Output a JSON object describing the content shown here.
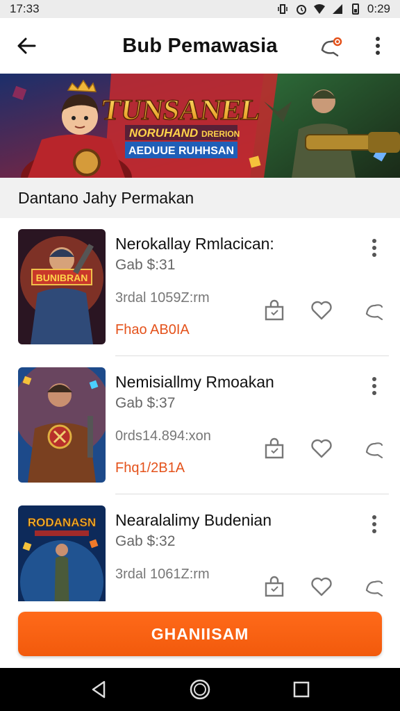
{
  "status": {
    "time": "17:33",
    "battery_time": "0:29"
  },
  "appbar": {
    "title": "Bub Pemawasia"
  },
  "banner": {
    "title": "TUNSANEL",
    "line1_a": "NORUHAND",
    "line1_b": "DRERION",
    "line2": "AEDUUE RUHHSAN"
  },
  "section": {
    "title": "Dantano Jahy Permakan"
  },
  "items": [
    {
      "name": "Nerokallay Rmlacican:",
      "price": "Gab $:31",
      "meta": "3rdal 1059Z:rm",
      "offer": "Fhao AB0IA",
      "thumb_text": "BUNIBRAN",
      "thumb_colors": [
        "#3a1a2e",
        "#b8452a"
      ]
    },
    {
      "name": "Nemisiallmy Rmoakan",
      "price": "Gab $:37",
      "meta": "0rds14.894:xon",
      "offer": "Fhq1/2B1A",
      "thumb_text": "",
      "thumb_colors": [
        "#1d4a8a",
        "#c8412a"
      ]
    },
    {
      "name": "Nearalalimy Budenian",
      "price": "Gab $:32",
      "meta": "3rdal 1061Z:rm",
      "offer": "",
      "thumb_text": "RODANASN",
      "thumb_colors": [
        "#0d2a5a",
        "#2d6fb5"
      ]
    }
  ],
  "cta": {
    "label": "GHANIISAM"
  },
  "colors": {
    "accent": "#f25a0c",
    "offer": "#e4521b"
  },
  "icons": [
    "back-arrow-icon",
    "share-icon",
    "more-vert-icon",
    "cart-icon",
    "heart-icon",
    "share-icon",
    "nav-back-icon",
    "nav-home-icon",
    "nav-recents-icon"
  ]
}
